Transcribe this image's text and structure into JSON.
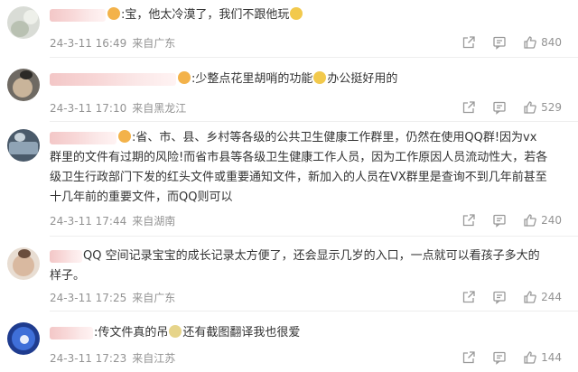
{
  "comments": [
    {
      "text": ":宝，他太冷漠了，我们不跟他玩",
      "timestamp": "24-3-11 16:49",
      "location": "来自广东",
      "likes": "840"
    },
    {
      "text": ":少整点花里胡哨的功能",
      "text_tail": "办公挺好用的",
      "timestamp": "24-3-11 17:10",
      "location": "来自黑龙江",
      "likes": "529"
    },
    {
      "lines": [
        ":省、市、县、乡村等各级的公共卫生健康工作群里，仍然在使用QQ群!因为vx",
        "群里的文件有过期的风险!而省市县等各级卫生健康工作人员，因为工作原因人员流动性大，若各",
        "级卫生行政部门下发的红头文件或重要通知文件，新加入的人员在VX群里是查询不到几年前甚至",
        "十几年前的重要文件，而QQ则可以"
      ],
      "timestamp": "24-3-11 17:44",
      "location": "来自湖南",
      "likes": "240"
    },
    {
      "lines": [
        "QQ 空间记录宝宝的成长记录太方便了，还会显示几岁的入口，一点就可以看孩子多大的",
        "样子。"
      ],
      "timestamp": "24-3-11 17:25",
      "location": "来自广东",
      "likes": "244"
    },
    {
      "text": ":传文件真的吊",
      "text_tail": "还有截图翻译我也很爱",
      "timestamp": "24-3-11 17:23",
      "location": "来自江苏",
      "likes": "144"
    }
  ],
  "colors": {
    "text": "#333333",
    "meta": "#939393",
    "divider": "#eeeeee",
    "name_mask": "#f3c7c7"
  },
  "icons": [
    "share-icon",
    "comment-icon",
    "like-icon",
    "emoji-icon"
  ]
}
